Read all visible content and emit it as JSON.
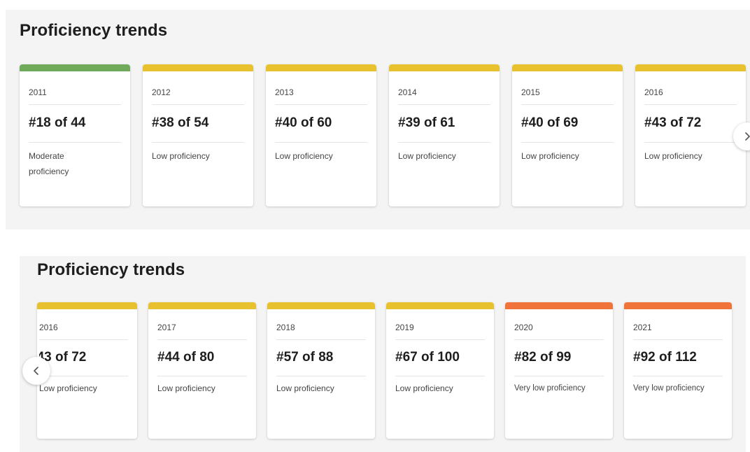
{
  "top_panel": {
    "title": "Proficiency trends",
    "cards": [
      {
        "year": "2011",
        "rank": "#18 of 44",
        "level": "Moderate proficiency",
        "color": "#6faa5a"
      },
      {
        "year": "2012",
        "rank": "#38 of 54",
        "level": "Low proficiency",
        "color": "#e8c22e"
      },
      {
        "year": "2013",
        "rank": "#40 of 60",
        "level": "Low proficiency",
        "color": "#e8c22e"
      },
      {
        "year": "2014",
        "rank": "#39 of 61",
        "level": "Low proficiency",
        "color": "#e8c22e"
      },
      {
        "year": "2015",
        "rank": "#40 of 69",
        "level": "Low proficiency",
        "color": "#e8c22e"
      },
      {
        "year": "2016",
        "rank": "#43 of 72",
        "level": "Low proficiency",
        "color": "#e8c22e"
      }
    ],
    "next_icon": "chevron-right-icon"
  },
  "bottom_panel": {
    "title": "Proficiency trends",
    "cards": [
      {
        "year": "2016",
        "rank": "#43 of 72",
        "level": "Low proficiency",
        "color": "#e8c22e"
      },
      {
        "year": "2017",
        "rank": "#44 of 80",
        "level": "Low proficiency",
        "color": "#e8c22e"
      },
      {
        "year": "2018",
        "rank": "#57 of 88",
        "level": "Low proficiency",
        "color": "#e8c22e"
      },
      {
        "year": "2019",
        "rank": "#67 of 100",
        "level": "Low proficiency",
        "color": "#e8c22e"
      },
      {
        "year": "2020",
        "rank": "#82 of 99",
        "level": "Very low proficiency",
        "color": "#f0733a"
      },
      {
        "year": "2021",
        "rank": "#92 of 112",
        "level": "Very low proficiency",
        "color": "#f0733a"
      }
    ],
    "prev_icon": "chevron-left-icon"
  }
}
